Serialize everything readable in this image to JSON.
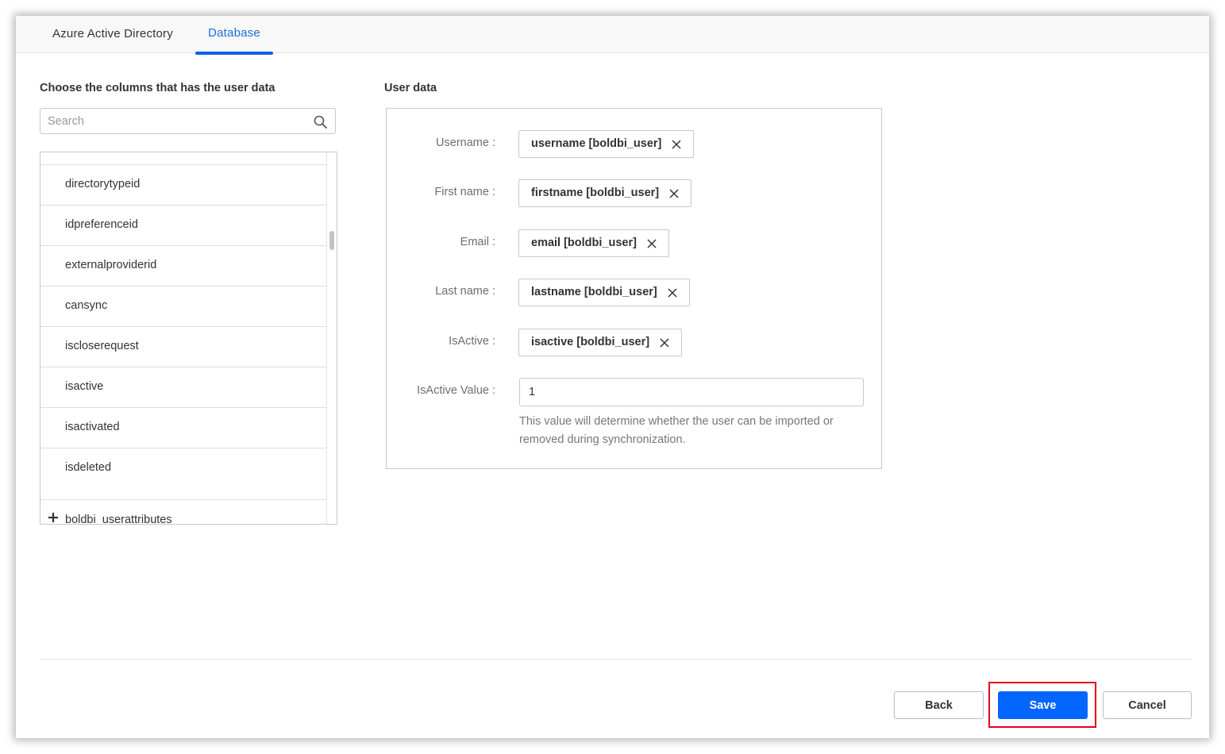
{
  "tabs": {
    "azure": "Azure Active Directory",
    "database": "Database"
  },
  "left": {
    "title": "Choose the columns that has the user data",
    "search_placeholder": "Search",
    "columns": [
      "directorytypeid",
      "idpreferenceid",
      "externalproviderid",
      "cansync",
      "iscloserequest",
      "isactive",
      "isactivated",
      "isdeleted"
    ],
    "group": "boldbi_userattributes"
  },
  "right": {
    "title": "User data",
    "fields": [
      {
        "label": "Username :",
        "value": "username [boldbi_user]"
      },
      {
        "label": "First name :",
        "value": "firstname [boldbi_user]"
      },
      {
        "label": "Email :",
        "value": "email [boldbi_user]"
      },
      {
        "label": "Last name :",
        "value": "lastname [boldbi_user]"
      },
      {
        "label": "IsActive :",
        "value": "isactive [boldbi_user]"
      }
    ],
    "isactive_value_label": "IsActive Value :",
    "isactive_value": "1",
    "help_text": "This value will determine whether the user can be imported or removed during synchronization."
  },
  "footer": {
    "back": "Back",
    "save": "Save",
    "cancel": "Cancel"
  },
  "colors": {
    "accent": "#0565ff",
    "tab_active": "#1a6ed8",
    "highlight": "#e3001b"
  },
  "icons": [
    "search-icon",
    "close-icon",
    "plus-icon"
  ]
}
